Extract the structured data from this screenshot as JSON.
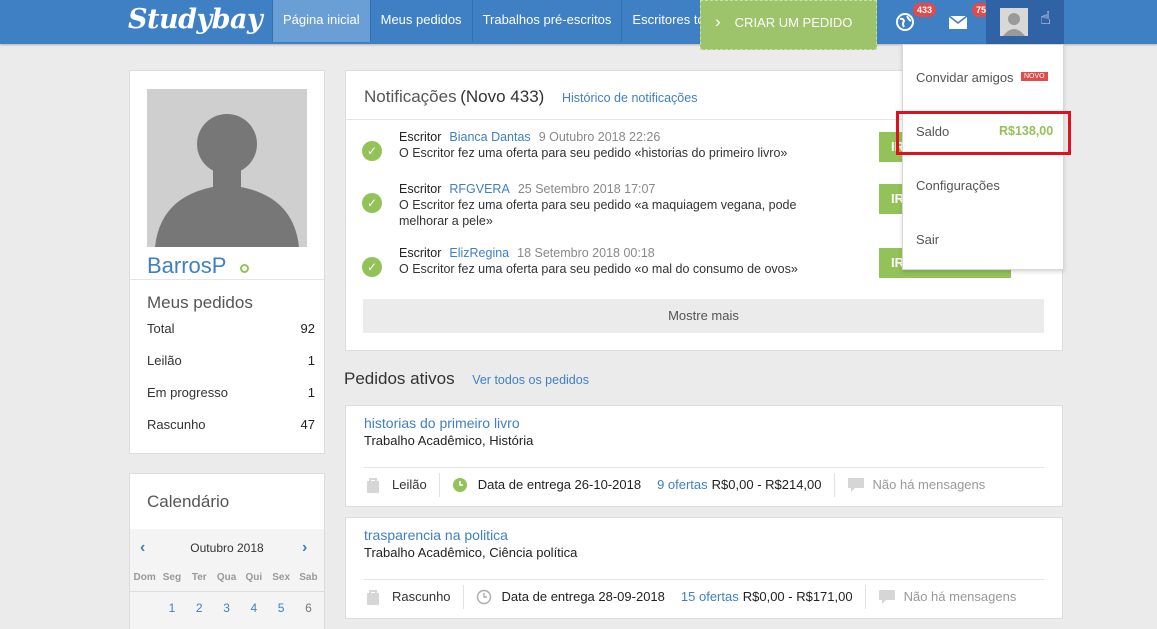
{
  "header": {
    "logo": "Studybay",
    "nav": [
      "Página inicial",
      "Meus pedidos",
      "Trabalhos pré-escritos",
      "Escritores top"
    ],
    "create_order": "CRIAR UM PEDIDO",
    "notifications_badge": "433",
    "messages_badge": "75"
  },
  "dropdown": {
    "invite": "Convidar amigos",
    "new_tag": "NOVO",
    "balance_label": "Saldo",
    "balance_value": "R$138,00",
    "settings": "Configurações",
    "logout": "Sair"
  },
  "profile": {
    "username": "BarrosP",
    "orders_title": "Meus pedidos",
    "stats": [
      {
        "label": "Total",
        "value": "92"
      },
      {
        "label": "Leilão",
        "value": "1"
      },
      {
        "label": "Em progresso",
        "value": "1"
      },
      {
        "label": "Rascunho",
        "value": "47"
      }
    ]
  },
  "calendar": {
    "title": "Calendário",
    "month": "Outubro 2018",
    "days": [
      "Dom",
      "Seg",
      "Ter",
      "Qua",
      "Qui",
      "Sex",
      "Sab"
    ],
    "first_week": [
      "",
      "1",
      "2",
      "3",
      "4",
      "5",
      "6"
    ]
  },
  "notifications": {
    "title": "Notificações",
    "count": "(Novo 433)",
    "history_link": "Histórico de notificações",
    "items": [
      {
        "role": "Escritor",
        "writer": "Bianca Dantas",
        "date": "9 Outubro 2018 22:26",
        "text": "O Escritor fez uma oferta para seu pedido «historias do primeiro livro»",
        "button": "IR"
      },
      {
        "role": "Escritor",
        "writer": "RFGVERA",
        "date": "25 Setembro 2018 17:07",
        "text": "O Escritor fez uma oferta para seu pedido «a maquiagem vegana, pode melhorar a pele»",
        "button": "IR"
      },
      {
        "role": "Escritor",
        "writer": "ElizRegina",
        "date": "18 Setembro 2018 00:18",
        "text": "O Escritor fez uma oferta para seu pedido «o mal do consumo de ovos»",
        "button": "IR"
      }
    ],
    "more": "Mostre mais"
  },
  "active_orders": {
    "title": "Pedidos ativos",
    "view_all": "Ver todos os pedidos",
    "orders": [
      {
        "title": "historias do primeiro livro",
        "subtitle": "Trabalho Acadêmico, História",
        "status": "Leilão",
        "deadline": "Data de entrega 26-10-2018",
        "offers": "9 ofertas",
        "price": "R$0,00 - R$214,00",
        "messages": "Não há mensagens"
      },
      {
        "title": "trasparencia na politica",
        "subtitle": "Trabalho Acadêmico, Ciência política",
        "status": "Rascunho",
        "deadline": "Data de entrega 28-09-2018",
        "offers": "15 ofertas",
        "price": "R$0,00 - R$171,00",
        "messages": "Não há mensagens"
      }
    ]
  },
  "colors": {
    "brand": "#3f7fc4",
    "green": "#93c258",
    "highlight": "#e0101c"
  }
}
